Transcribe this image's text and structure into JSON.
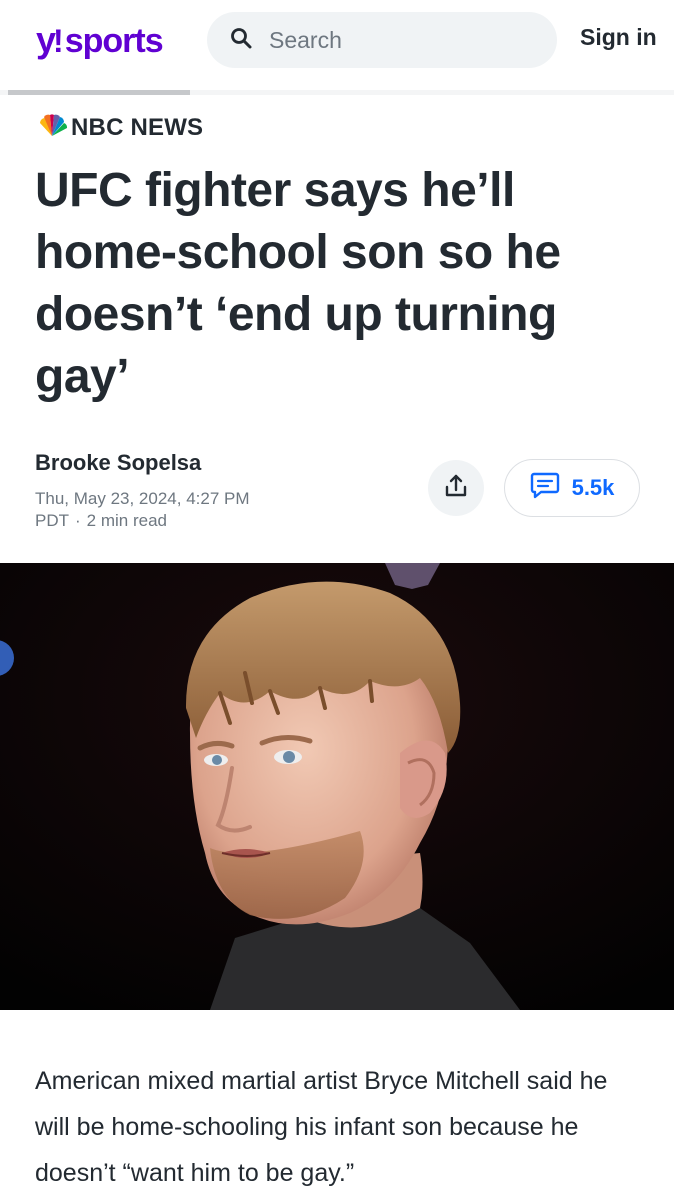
{
  "header": {
    "logo_y": "y",
    "logo_bang": "!",
    "logo_word": "sports",
    "search_placeholder": "Search",
    "sign_in": "Sign in",
    "brand_color": "#6001d2"
  },
  "reading_progress": 0.27,
  "article": {
    "source": "NBC NEWS",
    "headline": "UFC fighter says he’ll home-school son so he doesn’t ‘end up turning gay’",
    "author": "Brooke Sopelsa",
    "date": "Thu, May 23, 2024, 4:27 PM",
    "timezone": "PDT",
    "read_time": "2 min read",
    "comment_count": "5.5k",
    "body": "American mixed martial artist Bryce Mitchell said he will be home-schooling his infant son because he doesn’t “want him to be gay.”"
  },
  "icons": {
    "search": "search-icon",
    "share": "share-icon",
    "comments": "comment-bubble-icon",
    "source_logo": "nbc-peacock-logo"
  },
  "colors": {
    "accent_link": "#0f69ff",
    "text": "#232a31",
    "muted": "#6e7780"
  }
}
